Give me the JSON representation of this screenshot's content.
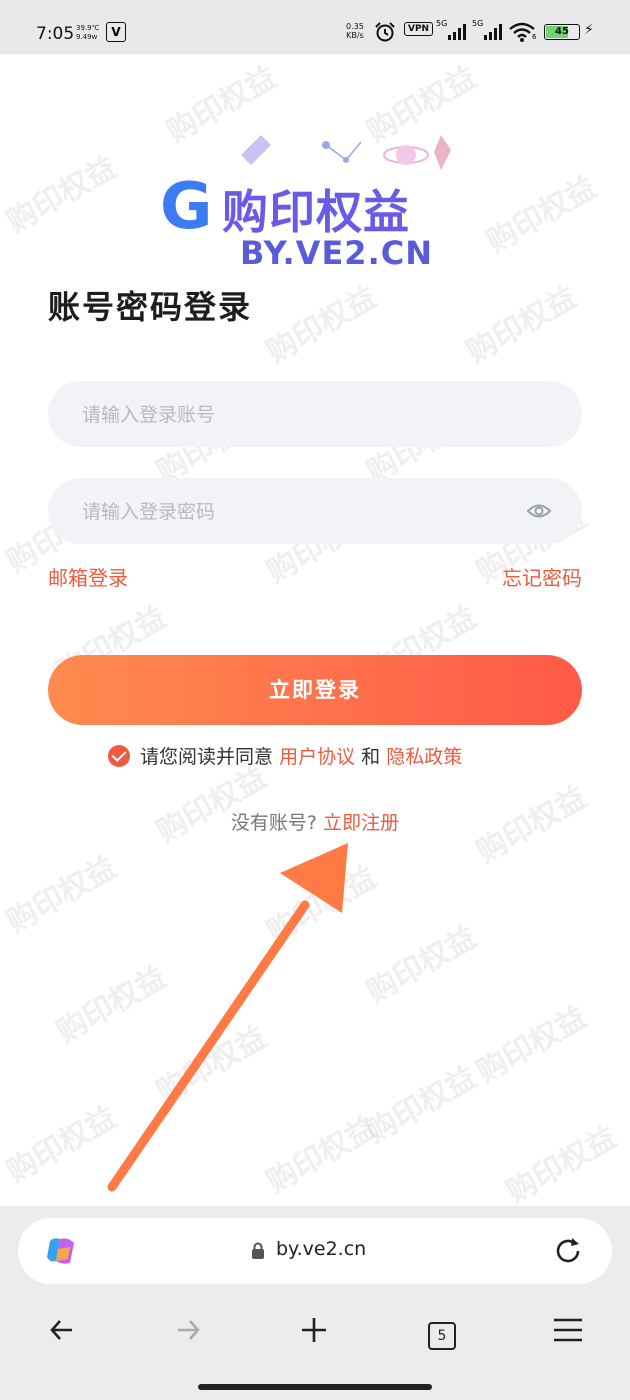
{
  "status_bar": {
    "time": "7:05",
    "temp": "39.9℃",
    "power": "9.49w",
    "net_speed_value": "0.35",
    "net_speed_unit": "KB/s",
    "vpn": "VPN",
    "signal1": "5G",
    "signal2": "5G",
    "wifi_sub": "6",
    "battery": "45"
  },
  "watermark": "购印权益",
  "logo": {
    "letter": "G",
    "name": "购印权益",
    "domain": "BY.VE2.CN"
  },
  "page_title": "账号密码登录",
  "form": {
    "account_placeholder": "请输入登录账号",
    "password_placeholder": "请输入登录密码",
    "email_login": "邮箱登录",
    "forgot_password": "忘记密码",
    "login_button": "立即登录"
  },
  "agreement": {
    "prefix": "请您阅读并同意",
    "user_agreement": "用户协议",
    "and": "和",
    "privacy_policy": "隐私政策"
  },
  "register": {
    "prompt": "没有账号?",
    "link": "立即注册"
  },
  "browser": {
    "url": "by.ve2.cn",
    "tab_count": "5"
  },
  "colors": {
    "accent": "#f05a3c",
    "button_start": "#ff8b4f",
    "button_end": "#ff5a48",
    "arrow": "#ff7a45"
  }
}
